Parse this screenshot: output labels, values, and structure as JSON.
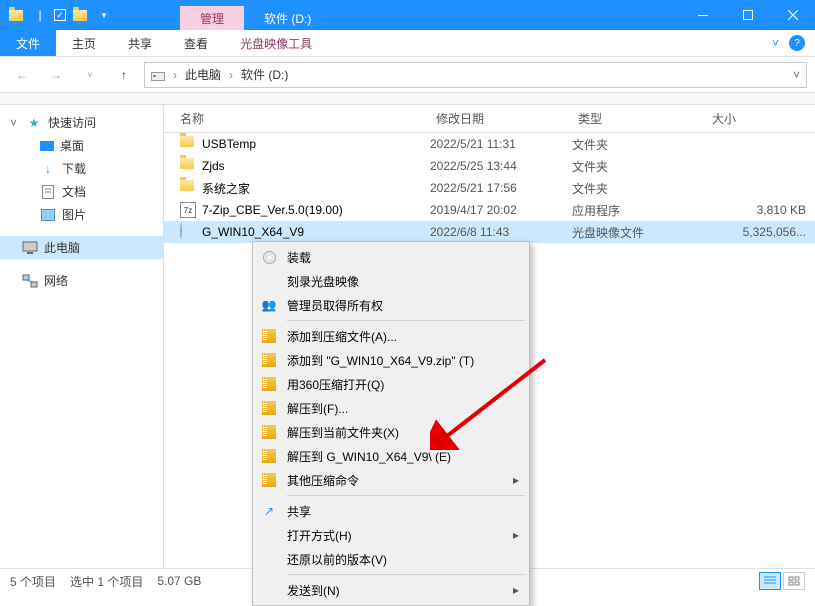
{
  "titlebar": {
    "manage_tab": "管理",
    "title": "软件 (D:)"
  },
  "ribbon": {
    "file": "文件",
    "home": "主页",
    "share": "共享",
    "view": "查看",
    "disc_tools": "光盘映像工具"
  },
  "breadcrumb": {
    "pc": "此电脑",
    "drive": "软件 (D:)"
  },
  "sidebar": {
    "quick": "快速访问",
    "desktop": "桌面",
    "downloads": "下载",
    "documents": "文档",
    "pictures": "图片",
    "thispc": "此电脑",
    "network": "网络"
  },
  "columns": {
    "name": "名称",
    "date": "修改日期",
    "type": "类型",
    "size": "大小"
  },
  "rows": [
    {
      "name": "USBTemp",
      "date": "2022/5/21 11:31",
      "type": "文件夹",
      "size": "",
      "icon": "folder"
    },
    {
      "name": "Zjds",
      "date": "2022/5/25 13:44",
      "type": "文件夹",
      "size": "",
      "icon": "folder"
    },
    {
      "name": "系统之家",
      "date": "2022/5/21 17:56",
      "type": "文件夹",
      "size": "",
      "icon": "folder"
    },
    {
      "name": "7-Zip_CBE_Ver.5.0(19.00)",
      "date": "2019/4/17 20:02",
      "type": "应用程序",
      "size": "3,810 KB",
      "icon": "zip"
    },
    {
      "name": "G_WIN10_X64_V9",
      "date": "2022/6/8 11:43",
      "type": "光盘映像文件",
      "size": "5,325,056...",
      "icon": "iso",
      "selected": true
    }
  ],
  "context_menu": {
    "mount": "装载",
    "burn": "刻录光盘映像",
    "admin": "管理员取得所有权",
    "add_archive": "添加到压缩文件(A)...",
    "add_to_zip": "添加到 \"G_WIN10_X64_V9.zip\" (T)",
    "open_360": "用360压缩打开(Q)",
    "extract_to": "解压到(F)...",
    "extract_here": "解压到当前文件夹(X)",
    "extract_named": "解压到 G_WIN10_X64_V9\\ (E)",
    "other_zip": "其他压缩命令",
    "share": "共享",
    "open_with": "打开方式(H)",
    "restore": "还原以前的版本(V)",
    "send_to": "发送到(N)"
  },
  "status": {
    "count": "5 个项目",
    "selection": "选中 1 个项目",
    "size": "5.07 GB"
  }
}
